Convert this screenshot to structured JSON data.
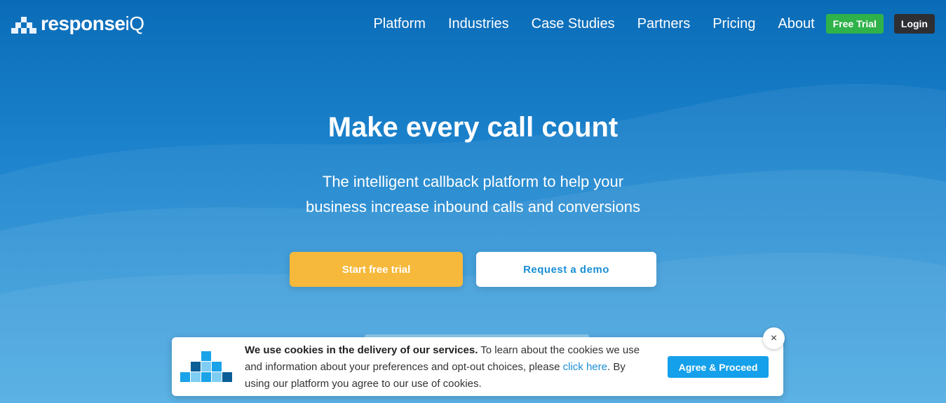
{
  "brand": {
    "name_main": "response",
    "name_suffix": "iQ"
  },
  "nav": {
    "links": [
      "Platform",
      "Industries",
      "Case Studies",
      "Partners",
      "Pricing",
      "About"
    ],
    "free_trial": "Free Trial",
    "login": "Login"
  },
  "hero": {
    "title": "Make every call count",
    "subtitle_line1": "The intelligent callback platform to help your",
    "subtitle_line2": "business increase inbound calls and conversions",
    "cta_trial": "Start free trial",
    "cta_demo": "Request a demo"
  },
  "cookie_banner": {
    "bold_text": "We use cookies in the delivery of our services.",
    "text_1": " To learn about the cookies we use and information about your preferences and opt-out choices, please ",
    "link_text": "click here",
    "text_2": ". By using our platform you agree to our use of cookies.",
    "agree_button": "Agree & Proceed",
    "close_icon": "close-icon",
    "close_glyph": "×"
  },
  "colors": {
    "accent_green": "#2fb24a",
    "cta_yellow": "#f6b93b",
    "link_blue": "#1a8fd6",
    "login_dark": "#2d2f33"
  }
}
